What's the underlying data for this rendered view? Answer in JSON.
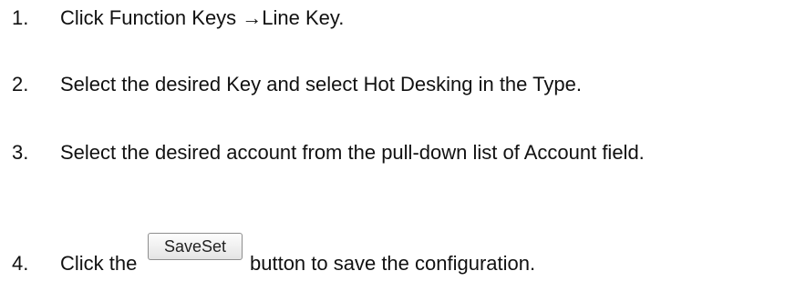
{
  "steps": [
    {
      "number": "1.",
      "text": "Click Function Keys →Line Key."
    },
    {
      "number": "2.",
      "text": "Select the desired Key and select Hot Desking in the Type."
    },
    {
      "number": "3.",
      "text": "Select the desired account from the pull-down list of Account field."
    },
    {
      "number": "4.",
      "text_before": "Click the",
      "button_label": "SaveSet",
      "text_after": "button to save the configuration."
    }
  ]
}
